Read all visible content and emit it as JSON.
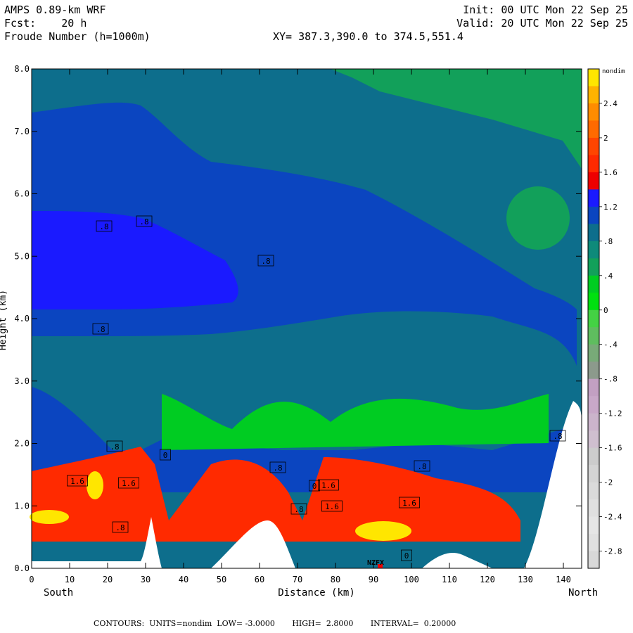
{
  "header": {
    "model": "AMPS 0.89-km WRF",
    "fcst": "Fcst:    20 h",
    "field": "Froude Number (h=1000m)",
    "init": "Init: 00 UTC Mon 22 Sep 25",
    "valid": "Valid: 20 UTC Mon 22 Sep 25",
    "xy": "XY= 387.3,390.0 to 374.5,551.4"
  },
  "footer": {
    "text": "CONTOURS:  UNITS=nondim  LOW= -3.0000       HIGH=  2.8000       INTERVAL=  0.20000"
  },
  "marker": "NZFX",
  "chart_data": {
    "type": "heatmap",
    "title": "Froude Number (h=1000m)",
    "xlabel": "Distance (km)",
    "ylabel": "Height (km)",
    "x_left_label": "South",
    "x_right_label": "North",
    "xlim": [
      0,
      145
    ],
    "ylim": [
      0,
      8
    ],
    "x_ticks": [
      0,
      10,
      20,
      30,
      40,
      50,
      60,
      70,
      80,
      90,
      100,
      110,
      120,
      130,
      140
    ],
    "y_ticks": [
      "0.0",
      "1.0",
      "2.0",
      "3.0",
      "4.0",
      "5.0",
      "6.0",
      "7.0",
      "8.0"
    ],
    "colorbar": {
      "unit": "nondim",
      "labels": [
        "2.4",
        "2",
        "1.6",
        "1.2",
        ".8",
        ".4",
        "0",
        "-.4",
        "-.8",
        "-1.2",
        "-1.6",
        "-2",
        "-2.4",
        "-2.8"
      ],
      "colors": [
        "#ffe600",
        "#ffb300",
        "#ff8c00",
        "#ff6a00",
        "#ff4500",
        "#ff2a00",
        "#ee0000",
        "#1a1aff",
        "#0b45c0",
        "#0d6e8c",
        "#0e8a7a",
        "#12a05a",
        "#00cc22",
        "#00e010",
        "#44d244",
        "#5fbd5f",
        "#78aa78",
        "#8c9a8c",
        "#c2a0c2",
        "#c8a8c8",
        "#cbb4cb",
        "#cfbfcf",
        "#cccccc",
        "#d4d4d4",
        "#dadada",
        "#e0e0e0",
        "#e5e5e5",
        "#e0e0e0",
        "#d8d8d8"
      ],
      "range": [
        -3.0,
        2.8
      ]
    },
    "contour_labels": [
      ".8",
      ".8",
      ".8",
      ".8",
      ".8",
      "1.6",
      "1.6",
      ".8",
      "0",
      ".8",
      "0",
      "1.6",
      "1.6",
      ".8",
      ".8",
      "1.6",
      "0",
      ".8"
    ],
    "low": -3.0,
    "high": 2.8,
    "interval": 0.2
  }
}
